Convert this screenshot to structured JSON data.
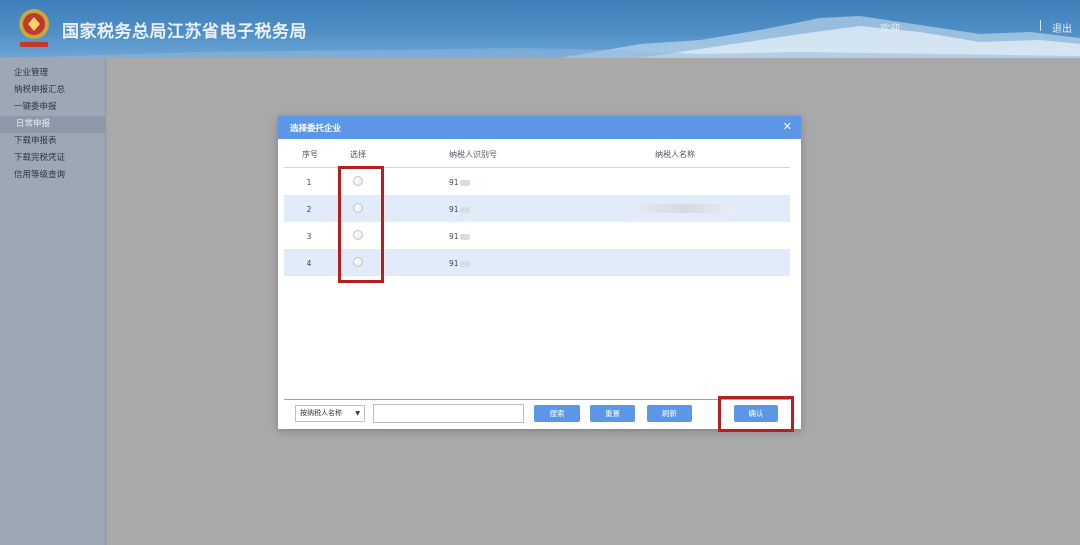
{
  "header": {
    "site_title": "国家税务总局江苏省电子税务局",
    "user_label": "欢迎",
    "logout_label": "退出",
    "colors": {
      "bar": "#4f8fc6",
      "title": "#e9f0f7"
    },
    "logo_icon": "tax-emblem-icon"
  },
  "sidebar": {
    "items": [
      {
        "label": "企业管理",
        "active": false
      },
      {
        "label": "纳税申报汇总",
        "active": false
      },
      {
        "label": "一键委申报",
        "active": false
      },
      {
        "label": "日常申报",
        "active": true
      },
      {
        "label": "下载申报表",
        "active": false
      },
      {
        "label": "下载完税凭证",
        "active": false
      },
      {
        "label": "信用等级查询",
        "active": false
      }
    ]
  },
  "modal": {
    "title": "选择委托企业",
    "close_icon": "close-icon",
    "columns": {
      "index": "序号",
      "select": "选择",
      "taxpayer_id": "纳税人识别号",
      "taxpayer_name": "纳税人名称"
    },
    "rows": [
      {
        "index": "1",
        "taxpayer_id": "91"
      },
      {
        "index": "2",
        "taxpayer_id": "91"
      },
      {
        "index": "3",
        "taxpayer_id": "91"
      },
      {
        "index": "4",
        "taxpayer_id": "91"
      }
    ],
    "toolbar": {
      "filter_selected": "按纳税人名称",
      "search_value": "",
      "search_label": "搜索",
      "reset_label": "重置",
      "refresh_label": "刷新",
      "confirm_label": "确认"
    },
    "colors": {
      "header": "#5b97e6",
      "button": "#5b97e6",
      "alt_row": "#e1ebf9",
      "annotation": "#b51f1f"
    }
  }
}
